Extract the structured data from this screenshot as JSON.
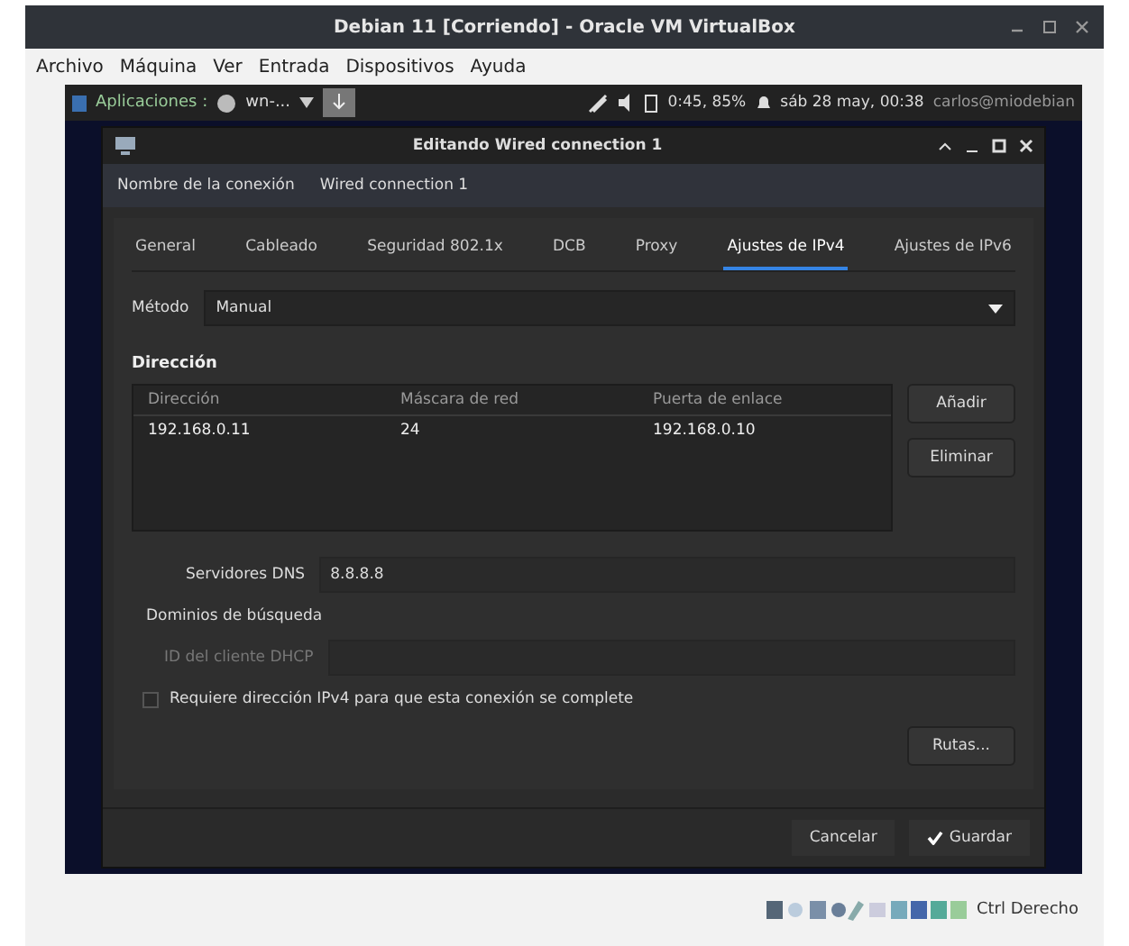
{
  "window": {
    "title": "Debian 11 [Corriendo] - Oracle VM VirtualBox"
  },
  "menu": [
    "Archivo",
    "Máquina",
    "Ver",
    "Entrada",
    "Dispositivos",
    "Ayuda"
  ],
  "guest_panel": {
    "apps": "Aplicaciones :",
    "task": "wn-...",
    "battery": "0:45, 85%",
    "clock": "sáb 28 may, 00:38",
    "user": "carlos@miodebian"
  },
  "dialog": {
    "title": "Editando Wired connection 1",
    "connection_name": {
      "label": "Nombre de la conexión",
      "value": "Wired connection 1"
    },
    "tabs": [
      {
        "label": "General",
        "selected": false
      },
      {
        "label": "Cableado",
        "selected": false
      },
      {
        "label": "Seguridad 802.1x",
        "selected": false
      },
      {
        "label": "DCB",
        "selected": false
      },
      {
        "label": "Proxy",
        "selected": false
      },
      {
        "label": "Ajustes de IPv4",
        "selected": true
      },
      {
        "label": "Ajustes de IPv6",
        "selected": false
      }
    ],
    "method": {
      "label": "Método",
      "value": "Manual"
    },
    "addresses": {
      "title": "Dirección",
      "columns": [
        "Dirección",
        "Máscara de red",
        "Puerta de enlace"
      ],
      "rows": [
        [
          "192.168.0.11",
          "24",
          "192.168.0.10"
        ]
      ],
      "buttons": [
        "Añadir",
        "Eliminar"
      ]
    },
    "dns": {
      "label": "Servidores DNS",
      "value": "8.8.8.8"
    },
    "search_domains": {
      "label": "Dominios de búsqueda"
    },
    "dhcp_client_id": {
      "label": "ID del cliente DHCP",
      "disabled": true
    },
    "require_ipv4": {
      "label": "Requiere dirección IPv4 para que esta conexión se complete",
      "checked": false
    },
    "routes_button": "Rutas...",
    "footer": {
      "cancel": "Cancelar",
      "save": "Guardar"
    }
  },
  "status_bar": {
    "host_key": "Ctrl Derecho"
  }
}
